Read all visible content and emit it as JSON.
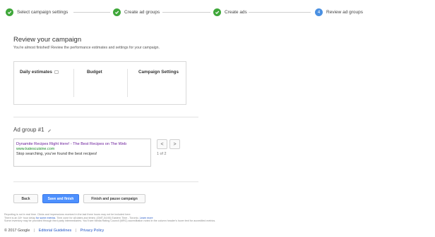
{
  "stepper": {
    "steps": [
      {
        "label": "Select campaign settings",
        "state": "done"
      },
      {
        "label": "Create ad groups",
        "state": "done"
      },
      {
        "label": "Create ads",
        "state": "done"
      },
      {
        "label": "Review ad groups",
        "state": "current",
        "number": "4"
      }
    ]
  },
  "review": {
    "title": "Review your campaign",
    "subtitle": "You're almost finished! Review the performance estimates and settings for your campaign."
  },
  "summary": {
    "daily_estimates": "Daily estimates",
    "budget": "Budget",
    "campaign_settings": "Campaign Settings"
  },
  "ad_group": {
    "title": "Ad group #1",
    "ad": {
      "headline": "Dynamite Recipes Right Here! - The Best Recipes on The Web",
      "url": "www.katescuisine.com",
      "description": "Stop searching, you've found the best recipes!"
    },
    "pager": {
      "prev": "<",
      "next": ">",
      "count": "1 of 2"
    }
  },
  "actions": {
    "back": "Back",
    "save": "Save and finish",
    "finish_pause": "Finish and pause campaign"
  },
  "notes": {
    "line1": "Reporting is not in real time. Clicks and impressions received in the last three hours may not be included here.",
    "line2_pre": "There is an 18+ hour delay",
    "line2_link": "for some metrics",
    "line2_post": ". Time zone for all dates and times: (GMT-04:00) Eastern Time - Toronto.",
    "line2_link2": "Learn more",
    "line3": "Some inventory may be provided through third party intermediaries. You'll see Media Rating Council (MRC) accreditation noted in the column header's hover text for accredited metrics."
  },
  "footer": {
    "copyright": "© 2017 Google",
    "editorial": "Editorial Guidelines",
    "privacy": "Privacy Policy"
  },
  "colors": {
    "done": "#3fa73a",
    "current": "#4a90e2",
    "primary_button": "#4d90fe",
    "link": "#2255c4",
    "ad_headline": "#6a1b9a",
    "ad_url": "#1a8a29"
  }
}
